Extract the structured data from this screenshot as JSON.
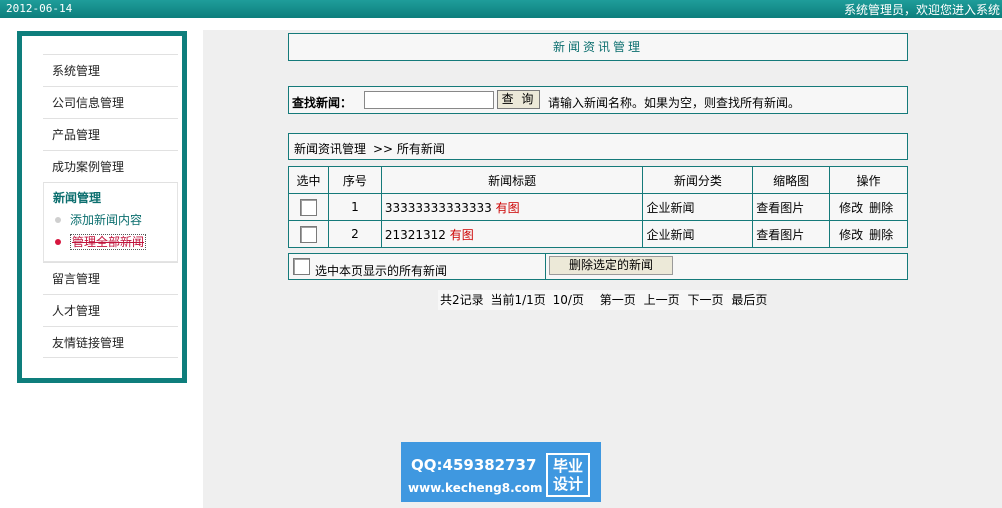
{
  "header": {
    "date": "2012-06-14",
    "welcome": "系统管理员，欢迎您进入系统"
  },
  "sidebar": {
    "items_top": [
      "系统管理",
      "公司信息管理",
      "产品管理",
      "成功案例管理"
    ],
    "group": {
      "title": "新闻管理",
      "sub_items": [
        "添加新闻内容",
        "管理全部新闻"
      ]
    },
    "items_bottom": [
      "留言管理",
      "人才管理",
      "友情链接管理"
    ]
  },
  "main": {
    "title": "新闻资讯管理",
    "search": {
      "label": "查找新闻：",
      "value": "",
      "button": "查 询",
      "hint": "请输入新闻名称。如果为空，则查找所有新闻。"
    },
    "breadcrumb": {
      "section": "新闻资讯管理",
      "current": ">> 所有新闻"
    },
    "table": {
      "headers": [
        "选中",
        "序号",
        "新闻标题",
        "新闻分类",
        "缩略图",
        "操作"
      ],
      "rows": [
        {
          "index": "1",
          "title": "33333333333333",
          "tag": "有图",
          "category": "企业新闻",
          "thumb": "查看图片",
          "edit": "修改",
          "delete": "删除"
        },
        {
          "index": "2",
          "title": "21321312",
          "tag": "有图",
          "category": "企业新闻",
          "thumb": "查看图片",
          "edit": "修改",
          "delete": "删除"
        }
      ]
    },
    "bulk": {
      "select_all": "选中本页显示的所有新闻",
      "delete_button": "删除选定的新闻"
    },
    "pager": {
      "total": "共2记录",
      "current": "当前1/1页",
      "per_page": "10/页",
      "first": "第一页",
      "prev": "上一页",
      "next": "下一页",
      "last": "最后页"
    }
  },
  "watermark": {
    "qq": "QQ:459382737",
    "url": "www.kecheng8.com",
    "stamp_line1": "毕业",
    "stamp_line2": "设计"
  }
}
